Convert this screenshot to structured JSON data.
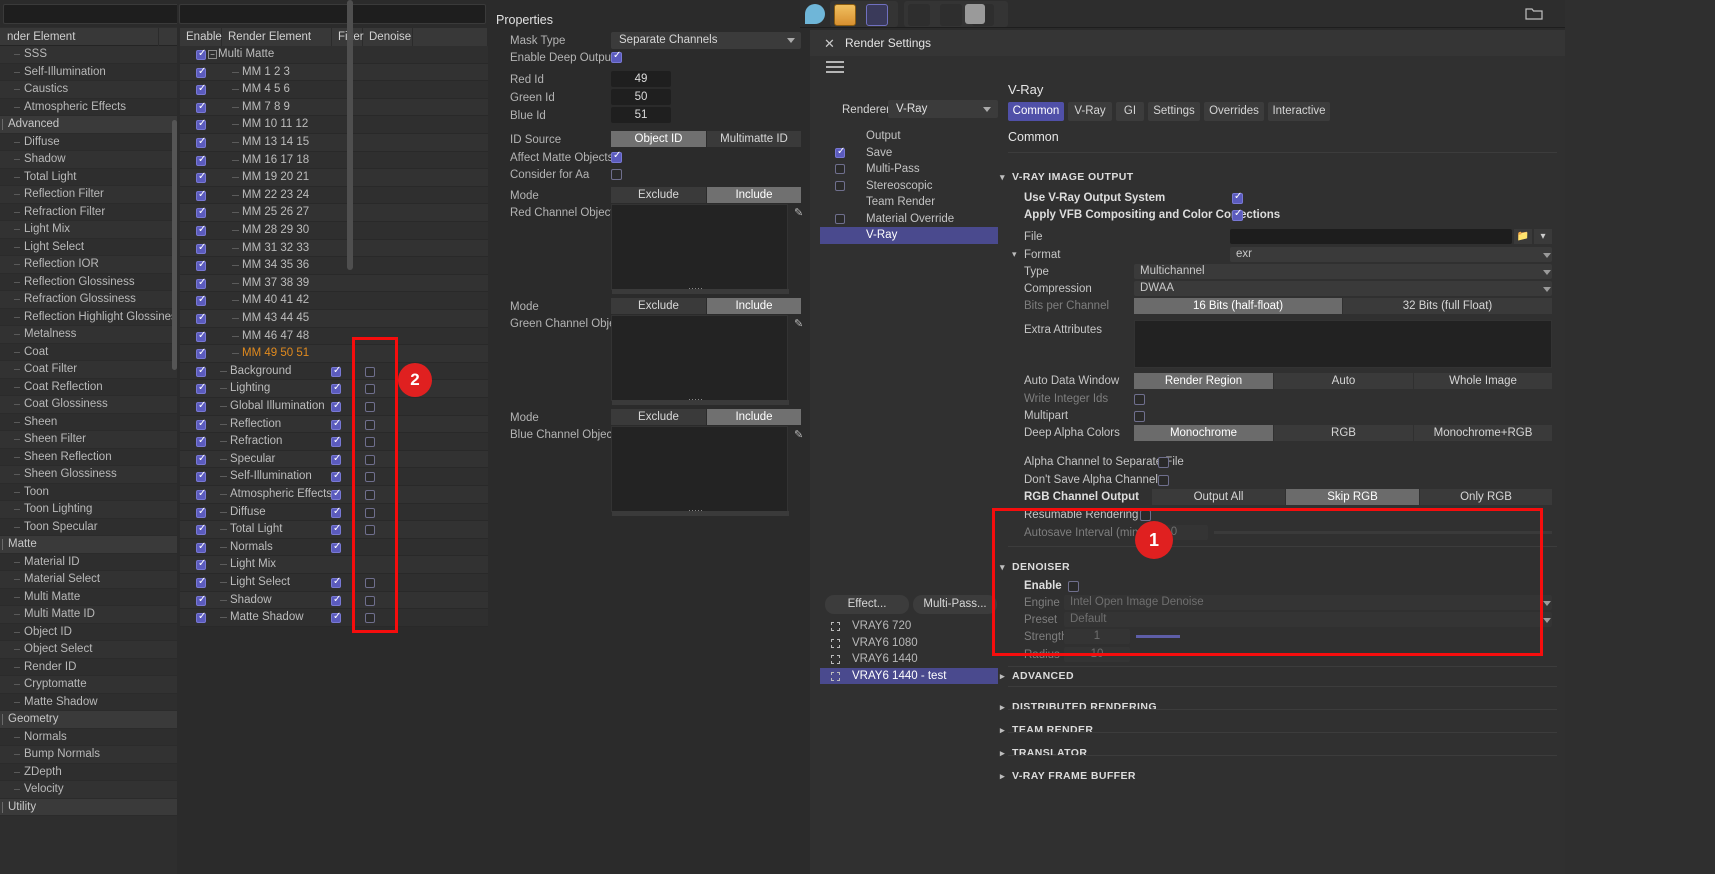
{
  "left_panel": {
    "search_placeholder": "",
    "column_header": "nder Element",
    "items": [
      {
        "label": "SSS",
        "type": "leaf"
      },
      {
        "label": "Self-Illumination",
        "type": "leaf"
      },
      {
        "label": "Caustics",
        "type": "leaf"
      },
      {
        "label": "Atmospheric Effects",
        "type": "leaf"
      },
      {
        "label": "Advanced",
        "type": "group"
      },
      {
        "label": "Diffuse",
        "type": "leaf"
      },
      {
        "label": "Shadow",
        "type": "leaf"
      },
      {
        "label": "Total Light",
        "type": "leaf"
      },
      {
        "label": "Reflection Filter",
        "type": "leaf"
      },
      {
        "label": "Refraction Filter",
        "type": "leaf"
      },
      {
        "label": "Light Mix",
        "type": "leaf"
      },
      {
        "label": "Light Select",
        "type": "leaf"
      },
      {
        "label": "Reflection IOR",
        "type": "leaf"
      },
      {
        "label": "Reflection Glossiness",
        "type": "leaf"
      },
      {
        "label": "Refraction Glossiness",
        "type": "leaf"
      },
      {
        "label": "Reflection Highlight Glossiness",
        "type": "leaf"
      },
      {
        "label": "Metalness",
        "type": "leaf"
      },
      {
        "label": "Coat",
        "type": "leaf"
      },
      {
        "label": "Coat Filter",
        "type": "leaf"
      },
      {
        "label": "Coat Reflection",
        "type": "leaf"
      },
      {
        "label": "Coat Glossiness",
        "type": "leaf"
      },
      {
        "label": "Sheen",
        "type": "leaf"
      },
      {
        "label": "Sheen Filter",
        "type": "leaf"
      },
      {
        "label": "Sheen Reflection",
        "type": "leaf"
      },
      {
        "label": "Sheen Glossiness",
        "type": "leaf"
      },
      {
        "label": "Toon",
        "type": "leaf"
      },
      {
        "label": "Toon Lighting",
        "type": "leaf"
      },
      {
        "label": "Toon Specular",
        "type": "leaf"
      },
      {
        "label": "Matte",
        "type": "group"
      },
      {
        "label": "Material ID",
        "type": "leaf"
      },
      {
        "label": "Material Select",
        "type": "leaf"
      },
      {
        "label": "Multi Matte",
        "type": "leaf"
      },
      {
        "label": "Multi Matte ID",
        "type": "leaf"
      },
      {
        "label": "Object ID",
        "type": "leaf"
      },
      {
        "label": "Object Select",
        "type": "leaf"
      },
      {
        "label": "Render ID",
        "type": "leaf"
      },
      {
        "label": "Cryptomatte",
        "type": "leaf"
      },
      {
        "label": "Matte Shadow",
        "type": "leaf"
      },
      {
        "label": "Geometry",
        "type": "group"
      },
      {
        "label": "Normals",
        "type": "leaf"
      },
      {
        "label": "Bump Normals",
        "type": "leaf"
      },
      {
        "label": "ZDepth",
        "type": "leaf"
      },
      {
        "label": "Velocity",
        "type": "leaf"
      },
      {
        "label": "Utility",
        "type": "group"
      }
    ]
  },
  "element_table": {
    "columns": [
      "Enable",
      "Render Element",
      "Filter",
      "Denoise"
    ],
    "rows": [
      {
        "label": "Multi Matte",
        "level": 0,
        "enable": true,
        "expander": "−",
        "filter": null,
        "denoise": null,
        "selected": false
      },
      {
        "label": "MM 1 2 3",
        "level": 2,
        "enable": true,
        "filter": null,
        "denoise": null,
        "selected": false
      },
      {
        "label": "MM 4 5 6",
        "level": 2,
        "enable": true,
        "filter": null,
        "denoise": null,
        "selected": false
      },
      {
        "label": "MM 7 8 9",
        "level": 2,
        "enable": true,
        "filter": null,
        "denoise": null,
        "selected": false
      },
      {
        "label": "MM 10 11 12",
        "level": 2,
        "enable": true,
        "filter": null,
        "denoise": null,
        "selected": false
      },
      {
        "label": "MM 13 14 15",
        "level": 2,
        "enable": true,
        "filter": null,
        "denoise": null,
        "selected": false
      },
      {
        "label": "MM 16 17 18",
        "level": 2,
        "enable": true,
        "filter": null,
        "denoise": null,
        "selected": false
      },
      {
        "label": "MM 19 20 21",
        "level": 2,
        "enable": true,
        "filter": null,
        "denoise": null,
        "selected": false
      },
      {
        "label": "MM 22 23 24",
        "level": 2,
        "enable": true,
        "filter": null,
        "denoise": null,
        "selected": false
      },
      {
        "label": "MM 25 26 27",
        "level": 2,
        "enable": true,
        "filter": null,
        "denoise": null,
        "selected": false
      },
      {
        "label": "MM 28 29 30",
        "level": 2,
        "enable": true,
        "filter": null,
        "denoise": null,
        "selected": false
      },
      {
        "label": "MM 31 32 33",
        "level": 2,
        "enable": true,
        "filter": null,
        "denoise": null,
        "selected": false
      },
      {
        "label": "MM 34 35 36",
        "level": 2,
        "enable": true,
        "filter": null,
        "denoise": null,
        "selected": false
      },
      {
        "label": "MM 37 38 39",
        "level": 2,
        "enable": true,
        "filter": null,
        "denoise": null,
        "selected": false
      },
      {
        "label": "MM 40 41 42",
        "level": 2,
        "enable": true,
        "filter": null,
        "denoise": null,
        "selected": false
      },
      {
        "label": "MM 43 44 45",
        "level": 2,
        "enable": true,
        "filter": null,
        "denoise": null,
        "selected": false
      },
      {
        "label": "MM 46 47 48",
        "level": 2,
        "enable": true,
        "filter": null,
        "denoise": null,
        "selected": false
      },
      {
        "label": "MM 49 50 51",
        "level": 2,
        "enable": true,
        "filter": null,
        "denoise": null,
        "selected": true
      },
      {
        "label": "Background",
        "level": 1,
        "enable": true,
        "filter": true,
        "denoise": false,
        "selected": false
      },
      {
        "label": "Lighting",
        "level": 1,
        "enable": true,
        "filter": true,
        "denoise": false,
        "selected": false
      },
      {
        "label": "Global Illumination",
        "level": 1,
        "enable": true,
        "filter": true,
        "denoise": false,
        "selected": false
      },
      {
        "label": "Reflection",
        "level": 1,
        "enable": true,
        "filter": true,
        "denoise": false,
        "selected": false
      },
      {
        "label": "Refraction",
        "level": 1,
        "enable": true,
        "filter": true,
        "denoise": false,
        "selected": false
      },
      {
        "label": "Specular",
        "level": 1,
        "enable": true,
        "filter": true,
        "denoise": false,
        "selected": false
      },
      {
        "label": "Self-Illumination",
        "level": 1,
        "enable": true,
        "filter": true,
        "denoise": false,
        "selected": false
      },
      {
        "label": "Atmospheric Effects",
        "level": 1,
        "enable": true,
        "filter": true,
        "denoise": false,
        "selected": false
      },
      {
        "label": "Diffuse",
        "level": 1,
        "enable": true,
        "filter": true,
        "denoise": false,
        "selected": false
      },
      {
        "label": "Total Light",
        "level": 1,
        "enable": true,
        "filter": true,
        "denoise": false,
        "selected": false
      },
      {
        "label": "Normals",
        "level": 1,
        "enable": true,
        "filter": true,
        "denoise": null,
        "selected": false
      },
      {
        "label": "Light Mix",
        "level": 1,
        "enable": true,
        "filter": null,
        "denoise": null,
        "selected": false
      },
      {
        "label": "Light Select",
        "level": 1,
        "enable": true,
        "filter": true,
        "denoise": false,
        "selected": false
      },
      {
        "label": "Shadow",
        "level": 1,
        "enable": true,
        "filter": true,
        "denoise": false,
        "selected": false
      },
      {
        "label": "Matte Shadow",
        "level": 1,
        "enable": true,
        "filter": true,
        "denoise": false,
        "selected": false
      }
    ]
  },
  "properties": {
    "title": "Properties",
    "mask_type": {
      "label": "Mask Type",
      "value": "Separate Channels"
    },
    "enable_deep_output": {
      "label": "Enable Deep Output",
      "value": true
    },
    "red_id": {
      "label": "Red Id",
      "value": "49"
    },
    "green_id": {
      "label": "Green Id",
      "value": "50"
    },
    "blue_id": {
      "label": "Blue Id",
      "value": "51"
    },
    "id_source": {
      "label": "ID Source",
      "options": [
        "Object ID",
        "Multimatte ID"
      ],
      "selected": "Object ID"
    },
    "affect_matte_objects": {
      "label": "Affect Matte Objects",
      "value": true
    },
    "consider_for_aa": {
      "label": "Consider for Aa",
      "value": false
    },
    "channels": [
      {
        "mode_label": "Mode",
        "mode_options": [
          "Exclude",
          "Include"
        ],
        "mode_selected": "Include",
        "list_label": "Red Channel Objects"
      },
      {
        "mode_label": "Mode",
        "mode_options": [
          "Exclude",
          "Include"
        ],
        "mode_selected": "Include",
        "list_label": "Green Channel Objects"
      },
      {
        "mode_label": "Mode",
        "mode_options": [
          "Exclude",
          "Include"
        ],
        "mode_selected": "Include",
        "list_label": "Blue Channel Objects"
      }
    ]
  },
  "render_settings": {
    "window_title": "Render Settings",
    "renderer_label": "Renderer",
    "renderer_value": "V-Ray",
    "nav_items": [
      {
        "label": "Output",
        "checkbox": null,
        "selected": false
      },
      {
        "label": "Save",
        "checkbox": true,
        "selected": false
      },
      {
        "label": "Multi-Pass",
        "checkbox": false,
        "selected": false
      },
      {
        "label": "Stereoscopic",
        "checkbox": false,
        "selected": false
      },
      {
        "label": "Team Render",
        "checkbox": null,
        "selected": false
      },
      {
        "label": "Material Override",
        "checkbox": false,
        "selected": false
      },
      {
        "label": "V-Ray",
        "checkbox": null,
        "selected": true
      }
    ],
    "buttons": [
      {
        "label": "Effect..."
      },
      {
        "label": "Multi-Pass..."
      }
    ],
    "presets": [
      {
        "label": "VRAY6 720",
        "selected": false
      },
      {
        "label": "VRAY6 1080",
        "selected": false
      },
      {
        "label": "VRAY6 1440",
        "selected": false
      },
      {
        "label": "VRAY6 1440 - test",
        "selected": true
      }
    ]
  },
  "vray": {
    "heading": "V-Ray",
    "tabs": [
      {
        "label": "Common",
        "selected": true
      },
      {
        "label": "V-Ray",
        "selected": false
      },
      {
        "label": "GI",
        "selected": false
      },
      {
        "label": "Settings",
        "selected": false
      },
      {
        "label": "Overrides",
        "selected": false
      },
      {
        "label": "Interactive",
        "selected": false
      }
    ],
    "section_title": "Common",
    "image_output": {
      "header": "V-RAY IMAGE OUTPUT",
      "use_vray_output_system": {
        "label": "Use V-Ray Output System",
        "value": true
      },
      "apply_vfb": {
        "label": "Apply VFB Compositing and Color Corrections",
        "value": true
      },
      "file": {
        "label": "File",
        "value": ""
      },
      "format": {
        "label": "Format",
        "value": "exr"
      },
      "type": {
        "label": "Type",
        "value": "Multichannel"
      },
      "compression": {
        "label": "Compression",
        "value": "DWAA"
      },
      "bits_per_channel": {
        "label": "Bits per Channel",
        "options": [
          "16 Bits (half-float)",
          "32 Bits (full Float)"
        ],
        "selected": "16 Bits (half-float)"
      },
      "extra_attributes": {
        "label": "Extra Attributes",
        "value": ""
      },
      "auto_data_window": {
        "label": "Auto Data Window",
        "options": [
          "Render Region",
          "Auto",
          "Whole Image"
        ],
        "selected": "Render Region"
      },
      "write_integer_ids": {
        "label": "Write Integer Ids",
        "value": false
      },
      "multipart": {
        "label": "Multipart",
        "value": false
      },
      "deep_alpha_colors": {
        "label": "Deep Alpha Colors",
        "options": [
          "Monochrome",
          "RGB",
          "Monochrome+RGB"
        ],
        "selected": "Monochrome"
      },
      "alpha_channel_to_separate_file": {
        "label": "Alpha Channel to Separate File",
        "value": false
      },
      "dont_save_alpha_channel": {
        "label": "Don't Save Alpha Channel",
        "value": false
      },
      "rgb_channel_output": {
        "label": "RGB Channel Output",
        "options": [
          "Output All",
          "Skip RGB",
          "Only RGB"
        ],
        "selected": "Skip RGB"
      },
      "resumable_rendering": {
        "label": "Resumable Rendering",
        "value": false
      },
      "autosave_interval": {
        "label": "Autosave Interval (minutes)",
        "value": "0"
      }
    },
    "denoiser": {
      "header": "DENOISER",
      "enable": {
        "label": "Enable",
        "value": false
      },
      "engine": {
        "label": "Engine",
        "value": "Intel Open Image Denoise"
      },
      "preset": {
        "label": "Preset",
        "value": "Default"
      },
      "strength": {
        "label": "Strength",
        "value": "1"
      },
      "radius": {
        "label": "Radius",
        "value": "10"
      },
      "advanced_header": "ADVANCED"
    },
    "collapsed_sections": [
      {
        "label": "DISTRIBUTED RENDERING"
      },
      {
        "label": "TEAM RENDER"
      },
      {
        "label": "TRANSLATOR"
      },
      {
        "label": "V-RAY FRAME BUFFER"
      }
    ]
  },
  "annotations": [
    {
      "number": "1",
      "target": "denoiser-section"
    },
    {
      "number": "2",
      "target": "denoise-column"
    }
  ],
  "colors": {
    "accent_blue": "#5b5bbd",
    "annotation_red": "#e02020",
    "selection_purple": "#4a4a8e",
    "highlight_orange": "#e08a1e"
  }
}
